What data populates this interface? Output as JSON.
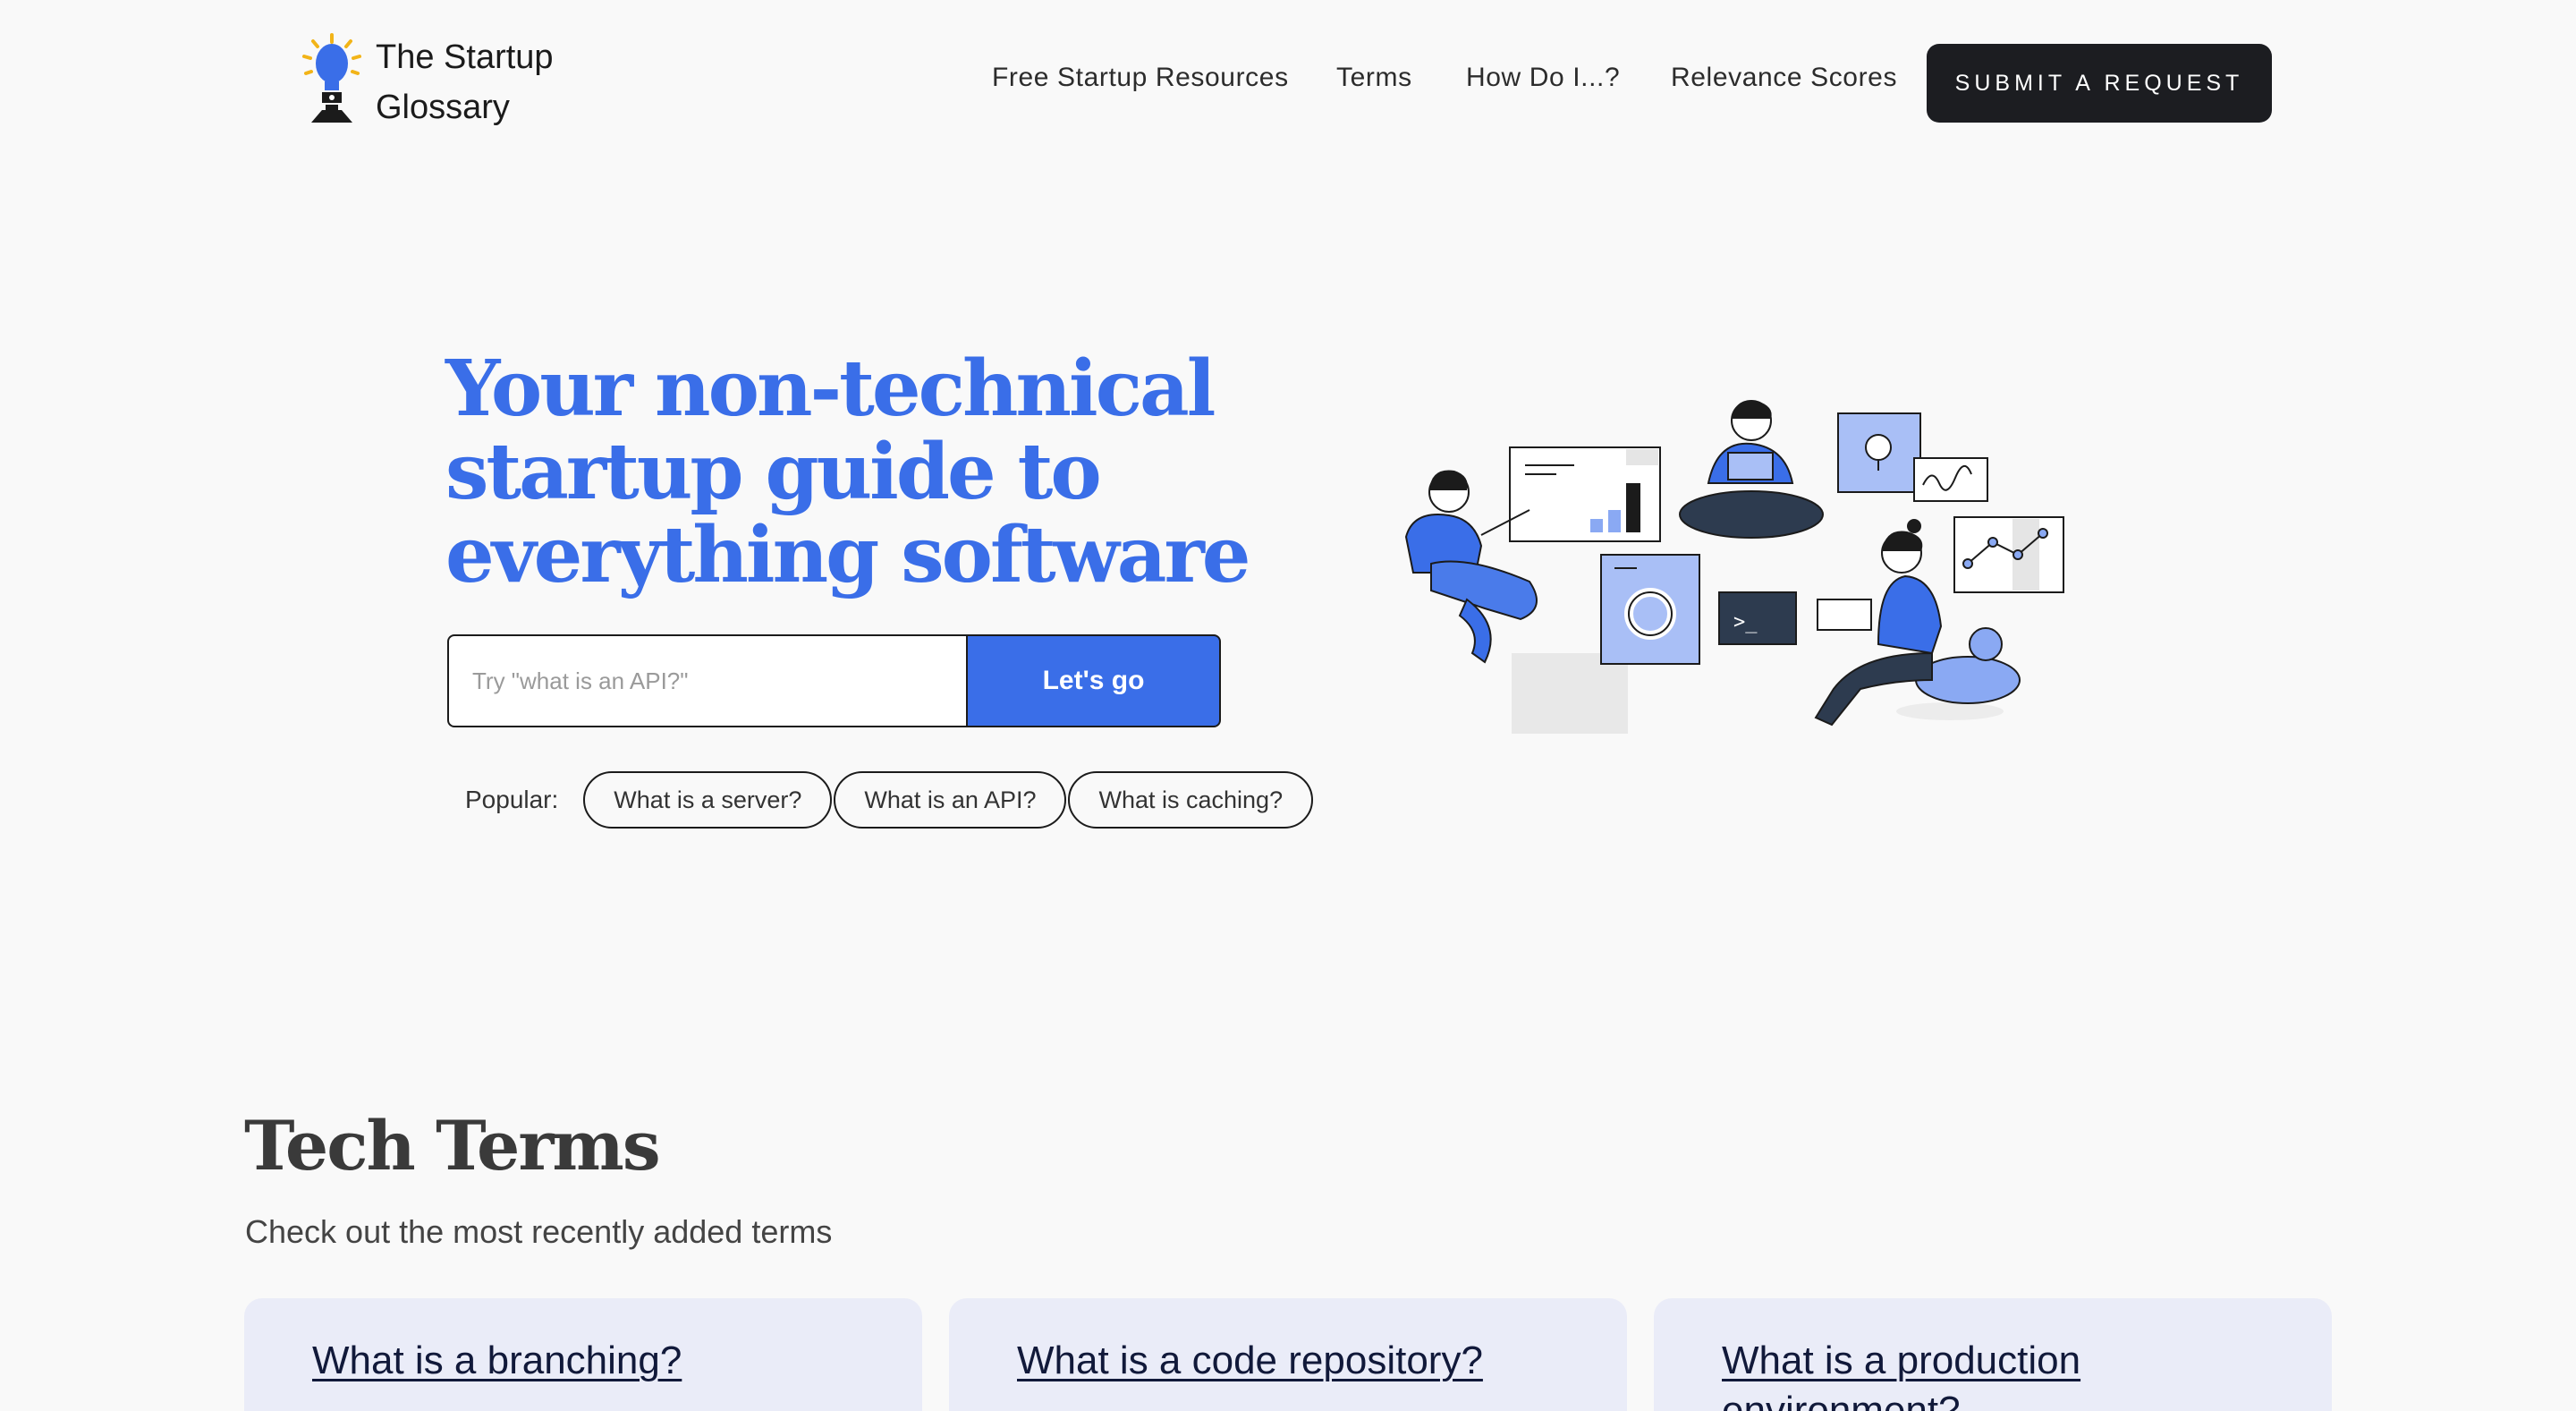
{
  "brand": {
    "name_line1": "The Startup",
    "name_line2": "Glossary"
  },
  "nav": {
    "items": [
      "Free Startup Resources",
      "Terms",
      "How Do I...?",
      "Relevance Scores"
    ],
    "cta": "SUBMIT A REQUEST"
  },
  "hero": {
    "title_line1": "Your non-technical",
    "title_line2": "startup guide to",
    "title_line3": "everything software",
    "search_placeholder": "Try \"what is an API?\"",
    "search_button": "Let's go",
    "popular_label": "Popular:",
    "popular": [
      "What is a server?",
      "What is an API?",
      "What is caching?"
    ]
  },
  "terms": {
    "title": "Tech Terms",
    "subtitle": "Check out the most recently added terms",
    "cards": [
      "What is a branching?",
      "What is a code repository?",
      "What is a production environment?"
    ]
  },
  "colors": {
    "accent": "#3a6ee8",
    "dark": "#1c1d21",
    "card_bg": "#eaecf8",
    "page_bg": "#f9f9f9"
  }
}
